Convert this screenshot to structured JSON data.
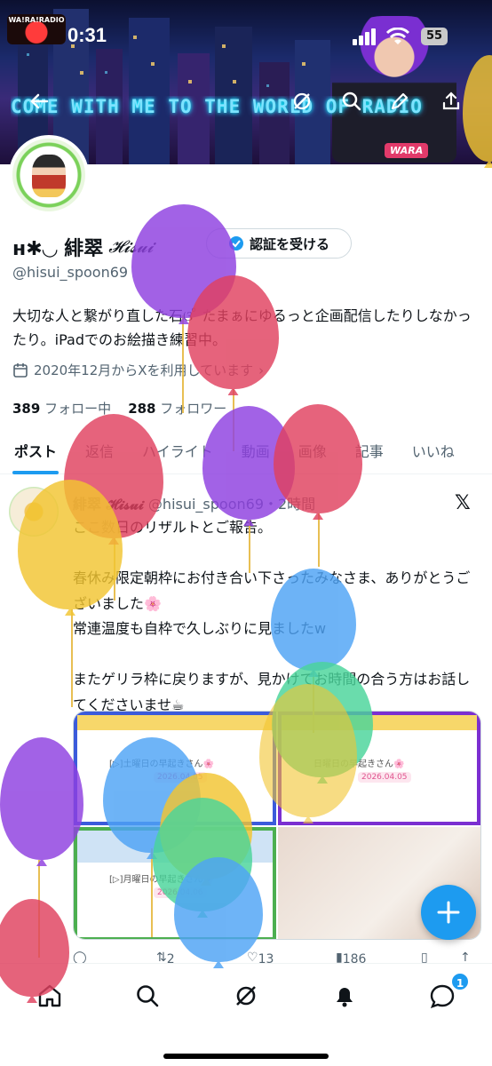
{
  "status_bar": {
    "time": "0:31",
    "battery": "55",
    "logo_text": "WA!RA!RADIO"
  },
  "banner": {
    "text": "COME WITH ME TO THE WORLD OF RADIO",
    "badge": "WARA"
  },
  "header_icons": [
    "back-arrow-icon",
    "grok-icon",
    "search-icon",
    "edit-icon",
    "share-icon"
  ],
  "profile": {
    "name": "ʜ✱◡ 緋翠",
    "name_script": "𝓗𝓲𝓼𝓾𝓲",
    "verify_button": "認証を受ける",
    "handle": "@hisui_spoon69",
    "bio": "大切な人と繋がり直した石ଓ ̊ たまぁにゆるっと企画配信したりしなかったり。iPadでのお絵描き練習中。",
    "joined": "2020年12月からXを利用しています",
    "following_count": "389",
    "following_label": "フォロー中",
    "followers_count": "288",
    "followers_label": "フォロワー"
  },
  "tabs": [
    {
      "label": "ポスト",
      "active": true
    },
    {
      "label": "返信",
      "active": false
    },
    {
      "label": "ハイライト",
      "active": false
    },
    {
      "label": "動画",
      "active": false
    },
    {
      "label": "画像",
      "active": false
    },
    {
      "label": "記事",
      "active": false
    },
    {
      "label": "いいね",
      "active": false
    }
  ],
  "post": {
    "author": "緋翠 𝓗𝓲𝓼𝓾𝓲",
    "handle_time": "@hisui_spoon69・2時間",
    "lines": [
      "ここ数日のリザルトとご報告。",
      "",
      "春休み限定朝枠にお付き合い下さったみなさま、ありがとうございました🌸",
      "常連温度も自枠で久しぶりに見ましたw",
      "",
      "またゲリラ枠に戻りますが、見かけてお時間の合う方はお話してくださいませ☕"
    ],
    "media": [
      {
        "caption": "[▷]土曜日の早起きさん🌸",
        "date": "2026.04.05"
      },
      {
        "caption": "日曜日の早起きさん🌸",
        "date": "2026.04.05"
      },
      {
        "caption": "[▷]月曜日の早起きさん🌸",
        "date": "2026.04.06"
      },
      {
        "caption": "",
        "date": ""
      }
    ],
    "retweets": "2",
    "likes": "13",
    "views": "186"
  },
  "bottom_nav": {
    "items": [
      "home-icon",
      "search-icon",
      "grok-icon",
      "notifications-icon",
      "messages-icon"
    ],
    "messages_badge": "1"
  },
  "colors": {
    "accent": "#1d9bf0",
    "balloons": [
      "#8e3fe0",
      "#e0415f",
      "#f2c531",
      "#4ea3f5",
      "#49d49a"
    ]
  }
}
